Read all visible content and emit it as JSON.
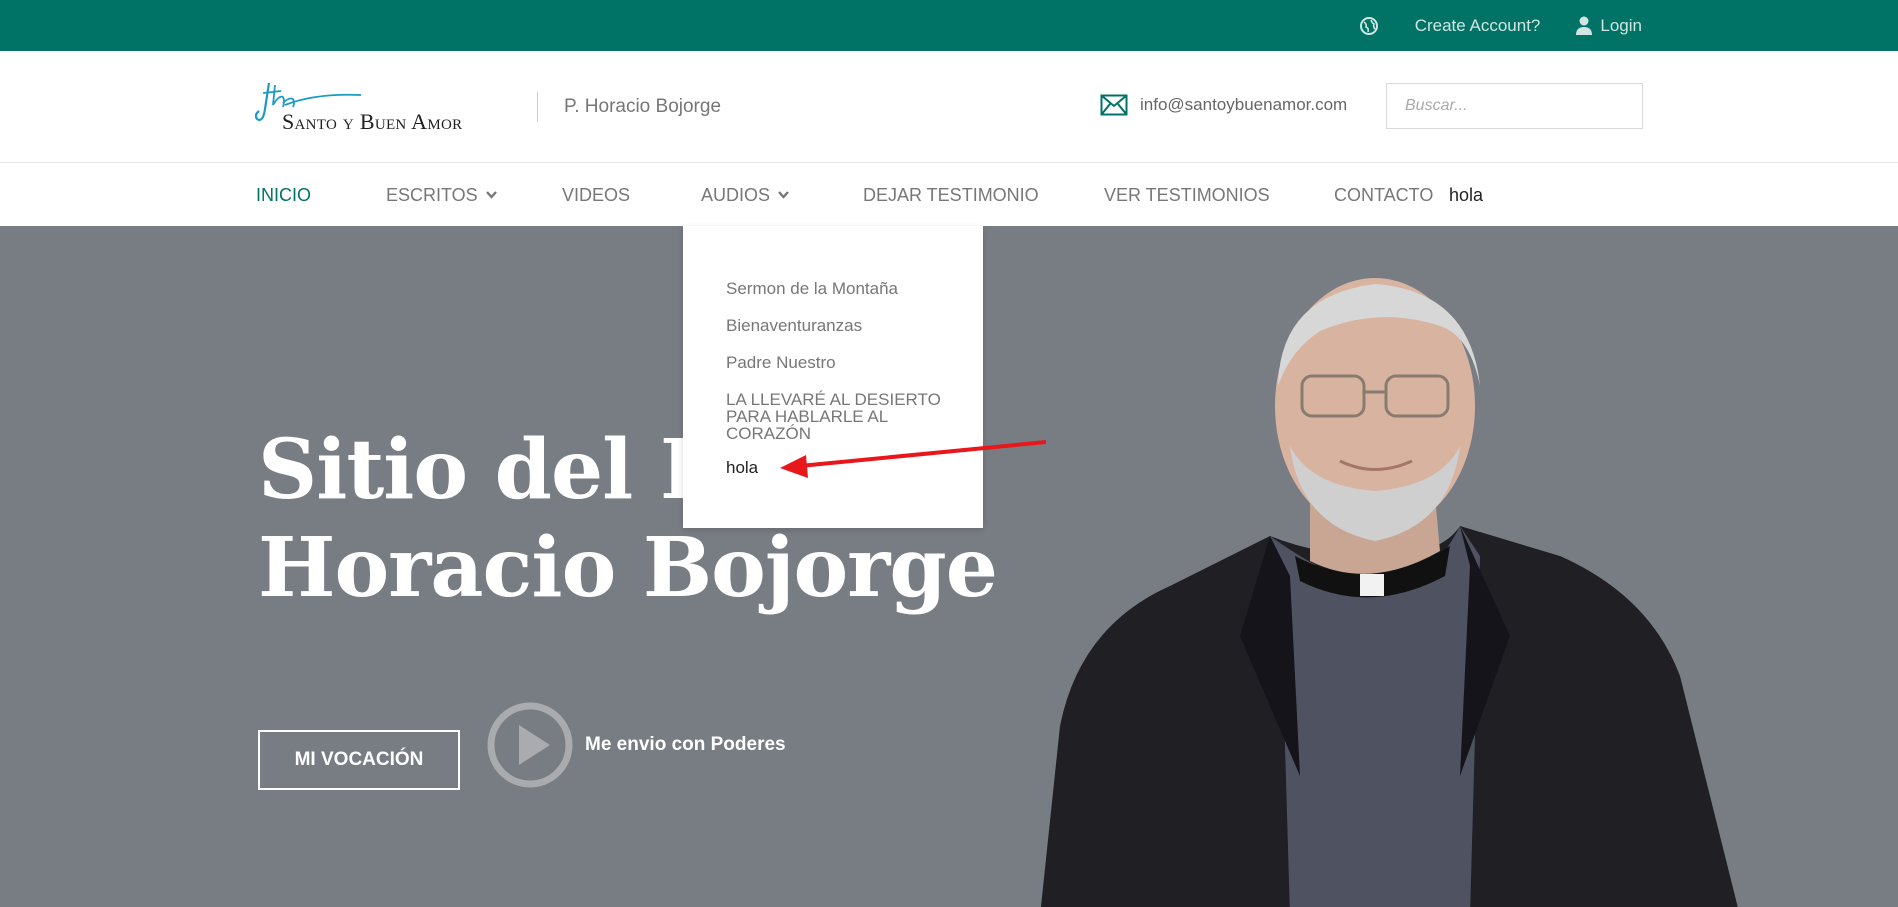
{
  "topbar": {
    "create_account": "Create Account?",
    "login": "Login",
    "icons": [
      "globe-icon",
      "user-icon"
    ]
  },
  "header": {
    "logo_text": "Santo y Buen Amor",
    "subtitle": "P. Horacio Bojorge",
    "email": "info@santoybuenamor.com",
    "search_placeholder": "Buscar..."
  },
  "nav": {
    "items": [
      {
        "label": "INICIO",
        "active": true
      },
      {
        "label": "ESCRITOS",
        "has_submenu": true
      },
      {
        "label": "VIDEOS"
      },
      {
        "label": "AUDIOS",
        "has_submenu": true
      },
      {
        "label": "DEJAR TESTIMONIO"
      },
      {
        "label": "VER TESTIMONIOS"
      },
      {
        "label": "CONTACTO"
      }
    ],
    "extra": "hola"
  },
  "dropdown": {
    "items": [
      "Sermon de la Montaña",
      "Bienaventuranzas",
      "Padre Nuestro",
      "LA LLEVARÉ AL DESIERTO PARA HABLARLE AL CORAZÓN",
      "hola"
    ]
  },
  "hero": {
    "title_line1": "Sitio del Pa",
    "title_line2": "Horacio Bojorge",
    "button": "MI VOCACIÓN",
    "play_label": "Me envio con Poderes"
  },
  "colors": {
    "brand": "#007266",
    "hero_bg": "#787d83",
    "annotation_arrow": "#e8171b"
  }
}
